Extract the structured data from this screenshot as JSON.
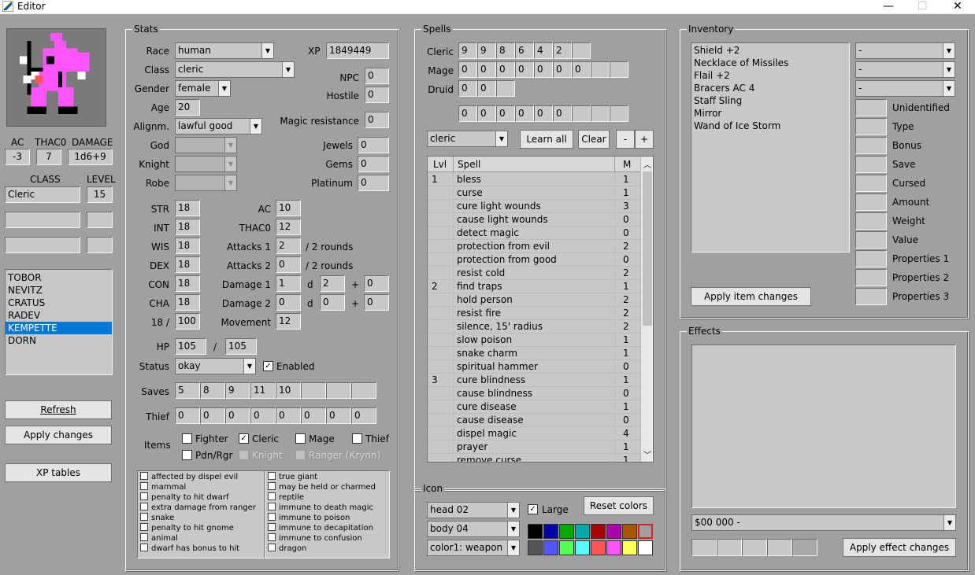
{
  "window": {
    "title": "Editor",
    "minimize": "—",
    "maximize": "☐",
    "close": "✕"
  },
  "left": {
    "ac_label": "AC",
    "thac0_label": "THAC0",
    "damage_label": "DAMAGE",
    "ac": "-3",
    "thac0": "7",
    "damage": "1d6+9",
    "class_label": "CLASS",
    "level_label": "LEVEL",
    "class1": "Cleric",
    "level1": "15",
    "roster": [
      "TOBOR",
      "NEVITZ",
      "CRATUS",
      "RADEV",
      "KEMPETTE",
      "DORN"
    ],
    "roster_selected": 4,
    "refresh": "Refresh",
    "apply": "Apply changes",
    "xp_tables": "XP tables"
  },
  "stats": {
    "title": "Stats",
    "race_label": "Race",
    "race": "human",
    "xp_label": "XP",
    "xp": "1849449",
    "class_label": "Class",
    "class": "cleric",
    "npc_label": "NPC",
    "npc": "0",
    "gender_label": "Gender",
    "gender": "female",
    "hostile_label": "Hostile",
    "hostile": "0",
    "age_label": "Age",
    "age": "20",
    "align_label": "Alignm.",
    "align": "lawful good",
    "mr_label": "Magic resistance",
    "mr": "0",
    "god_label": "God",
    "knight_label": "Knight",
    "robe_label": "Robe",
    "jewels_label": "Jewels",
    "jewels": "0",
    "gems_label": "Gems",
    "gems": "0",
    "plat_label": "Platinum",
    "plat": "0",
    "str_label": "STR",
    "str": "18",
    "int_label": "INT",
    "int": "18",
    "wis_label": "WIS",
    "wis": "18",
    "dex_label": "DEX",
    "dex": "18",
    "con_label": "CON",
    "con": "18",
    "cha_label": "CHA",
    "cha": "18",
    "exstr_label": "18 /",
    "exstr": "100",
    "ac_label": "AC",
    "ac": "10",
    "thac0_label": "THAC0",
    "thac0": "12",
    "att1_label": "Attacks 1",
    "att1": "2",
    "att1_suf": "/ 2 rounds",
    "att2_label": "Attacks 2",
    "att2": "0",
    "att2_suf": "/ 2 rounds",
    "dmg1_label": "Damage 1",
    "dmg1_n": "1",
    "dmg1_d": "2",
    "dmg1_p": "0",
    "dmg2_label": "Damage 2",
    "dmg2_n": "0",
    "dmg2_d": "0",
    "dmg2_p": "0",
    "d": "d",
    "plus": "+",
    "move_label": "Movement",
    "move": "12",
    "hp_label": "HP",
    "hp": "105",
    "hp_sep": "/",
    "hpmax": "105",
    "status_label": "Status",
    "status": "okay",
    "enabled_label": "Enabled",
    "saves_label": "Saves",
    "saves": [
      "5",
      "8",
      "9",
      "11",
      "10",
      "",
      "",
      " "
    ],
    "thief_label": "Thief",
    "thief": [
      "0",
      "0",
      "0",
      "0",
      "0",
      "0",
      "0",
      "0"
    ],
    "items_label": "Items",
    "items": [
      "Fighter",
      "Cleric",
      "Mage",
      "Thief",
      "Pdn/Rgr",
      "Knight",
      "Ranger (Krynn)"
    ],
    "flags_left": [
      "affected by dispel evil",
      "mammal",
      "penalty to hit dwarf",
      "extra damage from ranger",
      "snake",
      "penalty to hit gnome",
      "animal",
      "dwarf has bonus to hit"
    ],
    "flags_right": [
      "true giant",
      "may be held or charmed",
      "reptile",
      "immune to death magic",
      "immune to poison",
      "immune to decapitation",
      "immune to confusion",
      "dragon"
    ]
  },
  "spells": {
    "title": "Spells",
    "cleric_label": "Cleric",
    "cleric": [
      "9",
      "9",
      "8",
      "6",
      "4",
      "2",
      ""
    ],
    "mage_label": "Mage",
    "mage": [
      "0",
      "0",
      "0",
      "0",
      "0",
      "0",
      "0",
      "",
      ""
    ],
    "druid_label": "Druid",
    "druid": [
      "0",
      "0",
      ""
    ],
    "extra": [
      "0",
      "0",
      "0",
      "0",
      "0",
      "0",
      "",
      "",
      ""
    ],
    "school": "cleric",
    "learn_all": "Learn all",
    "clear": "Clear",
    "minus": "-",
    "plus": "+",
    "col_lvl": "Lvl",
    "col_spell": "Spell",
    "col_m": "M",
    "rows": [
      {
        "lvl": "1",
        "name": "bless",
        "m": "1"
      },
      {
        "lvl": "",
        "name": "curse",
        "m": "1"
      },
      {
        "lvl": "",
        "name": "cure light wounds",
        "m": "3"
      },
      {
        "lvl": "",
        "name": "cause light wounds",
        "m": "0"
      },
      {
        "lvl": "",
        "name": "detect magic",
        "m": "0"
      },
      {
        "lvl": "",
        "name": "protection from evil",
        "m": "2"
      },
      {
        "lvl": "",
        "name": "protection from good",
        "m": "0"
      },
      {
        "lvl": "",
        "name": "resist cold",
        "m": "2"
      },
      {
        "lvl": "2",
        "name": "find traps",
        "m": "1"
      },
      {
        "lvl": "",
        "name": "hold person",
        "m": "2"
      },
      {
        "lvl": "",
        "name": "resist fire",
        "m": "2"
      },
      {
        "lvl": "",
        "name": "silence, 15' radius",
        "m": "2"
      },
      {
        "lvl": "",
        "name": "slow poison",
        "m": "1"
      },
      {
        "lvl": "",
        "name": "snake charm",
        "m": "1"
      },
      {
        "lvl": "",
        "name": "spiritual hammer",
        "m": "0"
      },
      {
        "lvl": "3",
        "name": "cure blindness",
        "m": "1"
      },
      {
        "lvl": "",
        "name": "cause blindness",
        "m": "0"
      },
      {
        "lvl": "",
        "name": "cure disease",
        "m": "1"
      },
      {
        "lvl": "",
        "name": "cause disease",
        "m": "0"
      },
      {
        "lvl": "",
        "name": "dispel magic",
        "m": "4"
      },
      {
        "lvl": "",
        "name": "prayer",
        "m": "1"
      },
      {
        "lvl": "",
        "name": "remove curse",
        "m": "1"
      }
    ]
  },
  "icon": {
    "title": "Icon",
    "head": "head 02",
    "body": "body 04",
    "color": "color1: weapon",
    "large_label": "Large",
    "reset": "Reset colors",
    "swatches_top": [
      "#000000",
      "#0000aa",
      "#00aa00",
      "#00aaaa",
      "#aa0000",
      "#aa00aa",
      "#aa5500",
      "#aaaaaa"
    ],
    "swatches_bot": [
      "#555555",
      "#5555ff",
      "#55ff55",
      "#55ffff",
      "#ff5555",
      "#ff55ff",
      "#ffff55",
      "#ffffff"
    ]
  },
  "inventory": {
    "title": "Inventory",
    "items": [
      "Shield +2",
      "Necklace of Missiles",
      "Flail +2",
      "Bracers AC 4",
      "Staff Sling",
      "Mirror",
      "Wand of Ice Storm"
    ],
    "dd1": "-",
    "dd2": "-",
    "dd3": "-",
    "props": [
      "Unidentified",
      "Type",
      "Bonus",
      "Save",
      "Cursed",
      "Amount",
      "Weight",
      "Value",
      "Properties 1",
      "Properties 2",
      "Properties 3"
    ],
    "apply": "Apply item changes"
  },
  "effects": {
    "title": "Effects",
    "dd": "$00  000  -",
    "apply": "Apply effect changes"
  }
}
